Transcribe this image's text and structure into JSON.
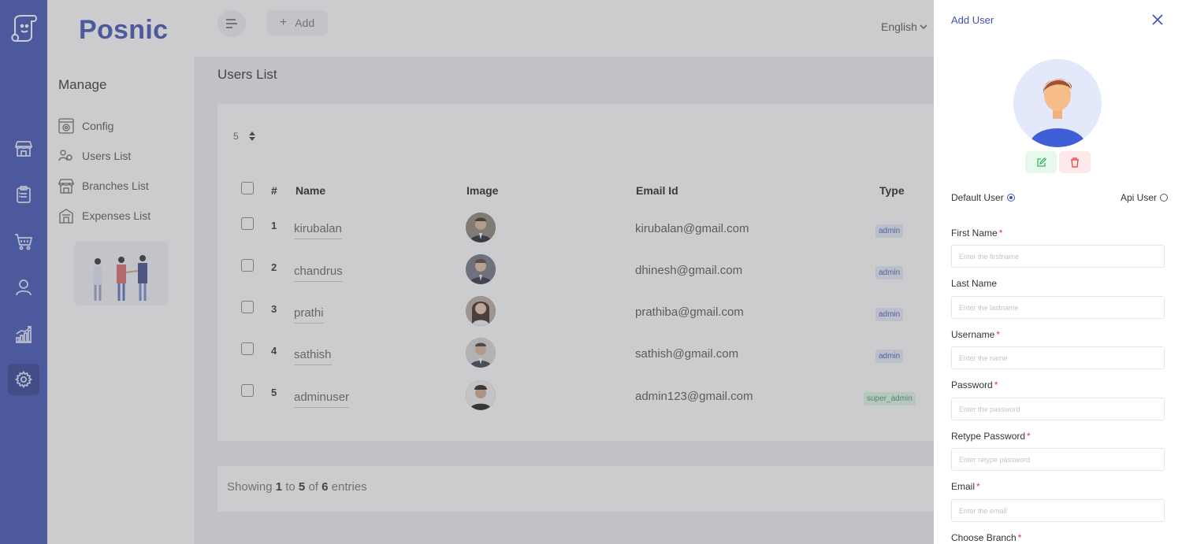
{
  "app": {
    "brand": "Posnic"
  },
  "colors": {
    "primary": "#3f51b5",
    "danger": "#e53935",
    "success": "#32a55c"
  },
  "rail": {
    "items": [
      {
        "icon": "store-icon"
      },
      {
        "icon": "clipboard-icon"
      },
      {
        "icon": "cart-icon"
      },
      {
        "icon": "user-icon"
      },
      {
        "icon": "chart-icon"
      },
      {
        "icon": "gear-icon",
        "active": true
      }
    ]
  },
  "sidebar": {
    "heading": "Manage",
    "items": [
      {
        "label": "Config",
        "icon": "config-icon"
      },
      {
        "label": "Users List",
        "icon": "users-icon",
        "active": true
      },
      {
        "label": "Branches List",
        "icon": "branch-icon"
      },
      {
        "label": "Expenses List",
        "icon": "expenses-icon"
      }
    ]
  },
  "topbar": {
    "add_label": "Add",
    "language": "English"
  },
  "main": {
    "title": "Users List",
    "per_page": "5",
    "columns": [
      "#",
      "Name",
      "Image",
      "Email Id",
      "Type"
    ],
    "rows": [
      {
        "num": "1",
        "name": "kirubalan",
        "email": "kirubalan@gmail.com",
        "type": "admin"
      },
      {
        "num": "2",
        "name": "chandrus",
        "email": "dhinesh@gmail.com",
        "type": "admin"
      },
      {
        "num": "3",
        "name": "prathi",
        "email": "prathiba@gmail.com",
        "type": "admin"
      },
      {
        "num": "4",
        "name": "sathish",
        "email": "sathish@gmail.com",
        "type": "admin"
      },
      {
        "num": "5",
        "name": "adminuser",
        "email": "admin123@gmail.com",
        "type": "super_admin"
      }
    ],
    "footer": {
      "prefix": "Showing",
      "from": "1",
      "to_word": "to",
      "to": "5",
      "of_word": "of",
      "total": "6",
      "suffix": "entries"
    }
  },
  "drawer": {
    "title": "Add User",
    "radio_default": "Default User",
    "radio_api": "Api User",
    "required_mark": "*",
    "fields": [
      {
        "label": "First Name",
        "placeholder": "Enter the firstname"
      },
      {
        "label": "Last Name",
        "placeholder": "Enter the lastname"
      },
      {
        "label": "Username",
        "placeholder": "Enter the name"
      },
      {
        "label": "Password",
        "placeholder": "Enter the password"
      },
      {
        "label": "Retype Password",
        "placeholder": "Enter retype password"
      },
      {
        "label": "Email",
        "placeholder": "Enter the email"
      },
      {
        "label": "Choose Branch"
      }
    ]
  }
}
